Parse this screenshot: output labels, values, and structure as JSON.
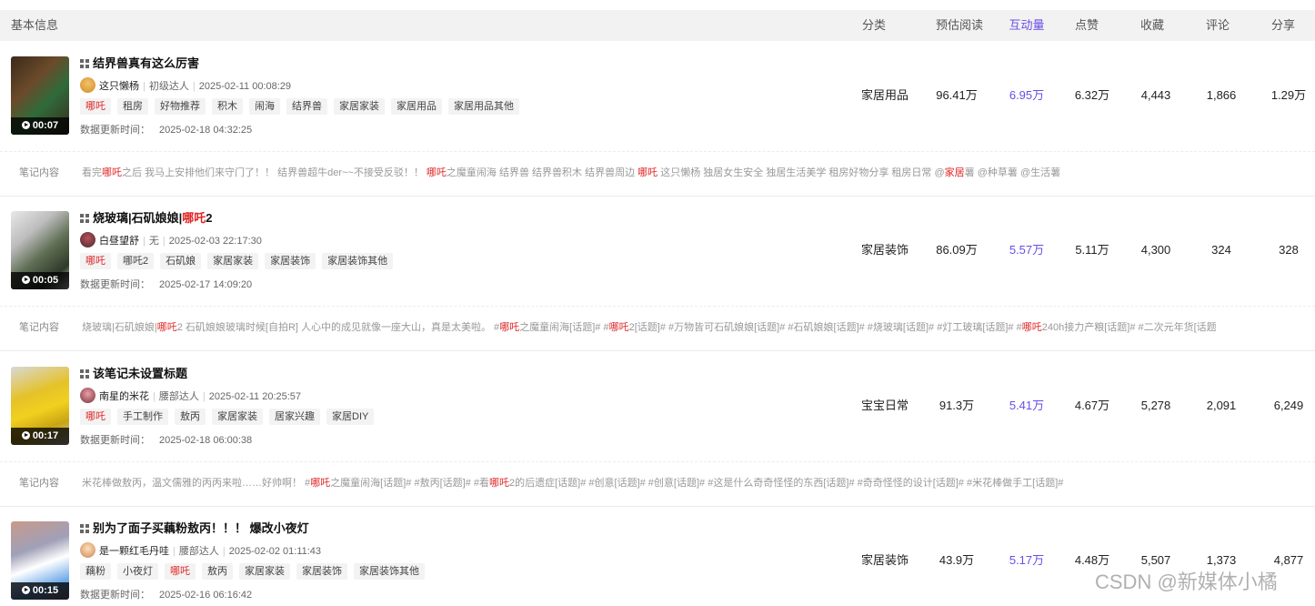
{
  "header": {
    "basic_info": "基本信息",
    "category": "分类",
    "est_reads": "预估阅读",
    "interactions": "互动量",
    "likes": "点赞",
    "favorites": "收藏",
    "comments": "评论",
    "shares": "分享"
  },
  "content_label": "笔记内容",
  "update_label": "数据更新时间：",
  "notes": [
    {
      "duration": "00:07",
      "title_parts": [
        "结界兽真有这么厉害"
      ],
      "author": "这只懒杨",
      "level": "初级达人",
      "publish_time": "2025-02-11 00:08:29",
      "tags": [
        "哪吒",
        "租房",
        "好物推荐",
        "积木",
        "闹海",
        "结界兽",
        "家居家装",
        "家居用品",
        "家居用品其他"
      ],
      "update_time": "2025-02-18 04:32:25",
      "category": "家居用品",
      "est_reads": "96.41万",
      "interactions": "6.95万",
      "likes": "6.32万",
      "favorites": "4,443",
      "comments": "1,866",
      "shares": "1.29万",
      "content_parts": [
        "看完",
        "哪吒",
        "之后 我马上安排他们来守门了！！ 结界兽超牛der~~不接受反驳！！ ",
        "哪吒",
        "之魔童闹海 结界兽 结界兽积木 结界兽周边 ",
        "哪吒",
        " 这只懒杨 独居女生安全 独居生活美学 租房好物分享 租房日常 @",
        "家居",
        "薯 @种草薯 @生活薯"
      ]
    },
    {
      "duration": "00:05",
      "title_parts": [
        "烧玻璃|石矶娘娘|",
        "哪吒",
        "2"
      ],
      "author": "白昼望舒",
      "level": "无",
      "publish_time": "2025-02-03 22:17:30",
      "tags": [
        "哪吒",
        "哪吒2",
        "石矶娘",
        "家居家装",
        "家居装饰",
        "家居装饰其他"
      ],
      "update_time": "2025-02-17 14:09:20",
      "category": "家居装饰",
      "est_reads": "86.09万",
      "interactions": "5.57万",
      "likes": "5.11万",
      "favorites": "4,300",
      "comments": "324",
      "shares": "328",
      "content_parts": [
        "烧玻璃|石矶娘娘|",
        "哪吒",
        "2 石矶娘娘玻璃时候[自拍R] 人心中的成见就像一座大山，真是太美啦。 #",
        "哪吒",
        "之魔童闹海[话题]# #",
        "哪吒",
        "2[话题]# #万物皆可石矶娘娘[话题]# #石矶娘娘[话题]# #烧玻璃[话题]# #灯工玻璃[话题]# #",
        "哪吒",
        "240h接力产粮[话题]# #二次元年货[话题"
      ]
    },
    {
      "duration": "00:17",
      "title_parts": [
        "该笔记未设置标题"
      ],
      "author": "南星的米花",
      "level": "腰部达人",
      "publish_time": "2025-02-11 20:25:57",
      "tags": [
        "哪吒",
        "手工制作",
        "敖丙",
        "家居家装",
        "居家兴趣",
        "家居DIY"
      ],
      "update_time": "2025-02-18 06:00:38",
      "category": "宝宝日常",
      "est_reads": "91.3万",
      "interactions": "5.41万",
      "likes": "4.67万",
      "favorites": "5,278",
      "comments": "2,091",
      "shares": "6,249",
      "content_parts": [
        "米花棒做敖丙，温文儒雅的丙丙来啦……好帅啊！ #",
        "哪吒",
        "之魔童闹海[话题]# #敖丙[话题]# #看",
        "哪吒",
        "2的后遗症[话题]# #创意[话题]# #创意[话题]# #这是什么奇奇怪怪的东西[话题]# #奇奇怪怪的设计[话题]# #米花棒做手工[话题]#"
      ]
    },
    {
      "duration": "00:15",
      "title_parts": [
        "别为了面子买藕粉敖丙！！！ 爆改小夜灯"
      ],
      "author": "是一颗红毛丹哇",
      "level": "腰部达人",
      "publish_time": "2025-02-02 01:11:43",
      "tags": [
        "藕粉",
        "小夜灯",
        "哪吒",
        "敖丙",
        "家居家装",
        "家居装饰",
        "家居装饰其他"
      ],
      "update_time": "2025-02-16 06:16:42",
      "category": "家居装饰",
      "est_reads": "43.9万",
      "interactions": "5.17万",
      "likes": "4.48万",
      "favorites": "5,507",
      "comments": "1,373",
      "shares": "4,877"
    }
  ],
  "highlight_word": "哪吒",
  "highlight_word_2": "家居",
  "watermark": "CSDN @新媒体小橘",
  "colors": {
    "accent": "#6a4ee6",
    "highlight": "#e02424"
  }
}
